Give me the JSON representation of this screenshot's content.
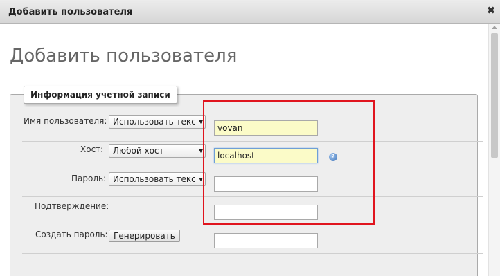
{
  "dialog": {
    "title": "Добавить пользователя",
    "close_glyph": "✖"
  },
  "page": {
    "heading": "Добавить пользователя"
  },
  "account_section": {
    "legend": "Информация учетной записи",
    "rows": [
      {
        "label": "Имя пользователя:",
        "select": "Использовать текс",
        "value": "vovan",
        "placeholder": ""
      },
      {
        "label": "Хост:",
        "select": "Любой хост",
        "value": "localhost",
        "placeholder": ""
      },
      {
        "label": "Пароль:",
        "select": "Использовать текс",
        "value": "",
        "placeholder": ""
      },
      {
        "label": "Подтверждение:",
        "value": "",
        "placeholder": ""
      },
      {
        "label": "Создать пароль:",
        "button": "Генерировать",
        "value": "",
        "placeholder": ""
      }
    ]
  },
  "icons": {
    "help": "question-icon",
    "close": "close-icon",
    "dropdown": "chevron-down-icon"
  },
  "colors": {
    "highlight_border": "#e0141e",
    "filled_input_bg": "#fbfbc8"
  }
}
